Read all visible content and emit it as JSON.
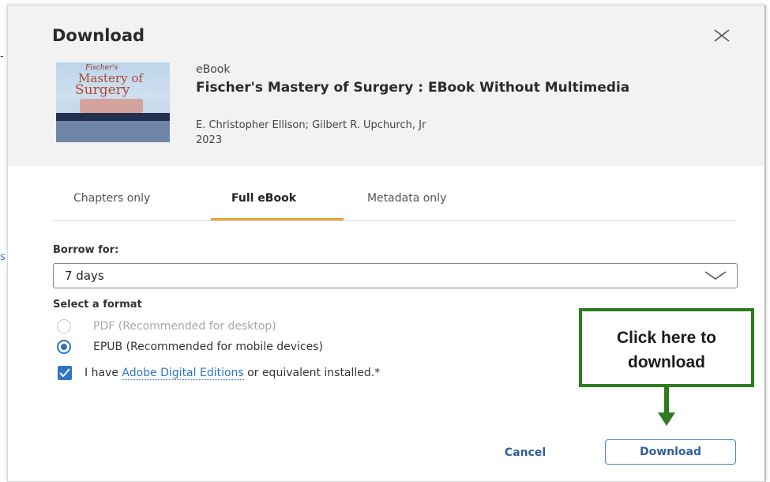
{
  "dialog": {
    "title": "Download",
    "book": {
      "type": "eBook",
      "title": "Fischer's Mastery of Surgery : EBook Without Multimedia",
      "authors": "E. Christopher Ellison; Gilbert R. Upchurch, Jr",
      "year": "2023",
      "cover": {
        "author_text": "Fischer's",
        "title_line1": "Mastery of",
        "title_line2": "Surgery"
      }
    },
    "tabs": [
      {
        "label": "Chapters only",
        "active": false
      },
      {
        "label": "Full eBook",
        "active": true
      },
      {
        "label": "Metadata only",
        "active": false
      }
    ],
    "borrow": {
      "label": "Borrow for:",
      "value": "7 days"
    },
    "format": {
      "label": "Select a format",
      "options": [
        {
          "label": "PDF (Recommended for desktop)",
          "selected": false,
          "enabled": false
        },
        {
          "label": "EPUB (Recommended for mobile devices)",
          "selected": true,
          "enabled": true
        }
      ]
    },
    "agreement": {
      "checked": true,
      "prefix": "I have ",
      "link": "Adobe Digital Editions",
      "suffix": " or equivalent installed.*"
    },
    "buttons": {
      "cancel": "Cancel",
      "download": "Download"
    }
  },
  "callout": {
    "line1": "Click here to",
    "line2": "download"
  },
  "colors": {
    "accent": "#2f74c6",
    "tab_underline": "#e9a23b",
    "callout_border": "#2e7a1f",
    "header_bg": "#f2f2f2"
  }
}
